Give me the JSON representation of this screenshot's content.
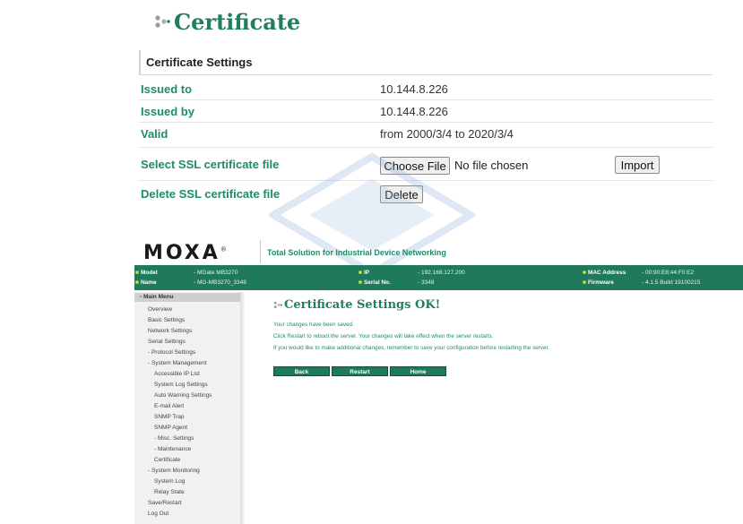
{
  "certificate": {
    "title": "Certificate",
    "section_heading": "Certificate Settings",
    "rows": [
      {
        "label": "Issued to",
        "value": "10.144.8.226"
      },
      {
        "label": "Issued by",
        "value": "10.144.8.226"
      },
      {
        "label": "Valid",
        "value": "from 2000/3/4 to 2020/3/4"
      }
    ],
    "select_label": "Select SSL certificate file",
    "choose_file_label": "Choose File",
    "no_file_text": "No file chosen",
    "import_label": "Import",
    "delete_row_label": "Delete SSL certificate file",
    "delete_button_label": "Delete"
  },
  "moxa": {
    "logo": "MOXA",
    "logo_mark": "®",
    "tagline": "Total Solution for Industrial Device Networking",
    "info": {
      "model_key": "Model",
      "model_val": "- MGate MB3270",
      "name_key": "Name",
      "name_val": "- MG-MB3270_3348",
      "ip_key": "IP",
      "ip_val": "- 192.168.127.200",
      "serial_key": "Serial No.",
      "serial_val": "- 3348",
      "mac_key": "MAC Address",
      "mac_val": "- 00:90:E8:44:F0:E2",
      "fw_key": "Firmware",
      "fw_val": "- 4.1.5 Build 19100215"
    },
    "menu_head": "- Main Menu",
    "menu": [
      "Overview",
      "Basic Settings",
      "Network Settings",
      "Serial Settings",
      "- Protocol Settings",
      "- System Management",
      "Accessible IP List",
      "System Log Settings",
      "Auto Warning Settings",
      "E-mail Alert",
      "SNMP Trap",
      "SNMP Agent",
      "- Misc. Settings",
      "- Maintenance",
      "Certificate",
      "- System Monitoring",
      "System Log",
      "Relay State",
      "Save/Restart",
      "Log Out"
    ],
    "ok_title": "Certificate Settings OK!",
    "messages": [
      "Your changes have been saved.",
      "Click Restart to reboot the server. Your changes will take effect when the server restarts.",
      "If you would like to make additional changes, remember to save your configuration before restarting the server."
    ],
    "buttons": {
      "back": "Back",
      "restart": "Restart",
      "home": "Home"
    }
  },
  "colors": {
    "accent_green": "#1e8c6b",
    "bar_green": "#1f7a5c",
    "bullet_yellow": "#d7e63a"
  }
}
